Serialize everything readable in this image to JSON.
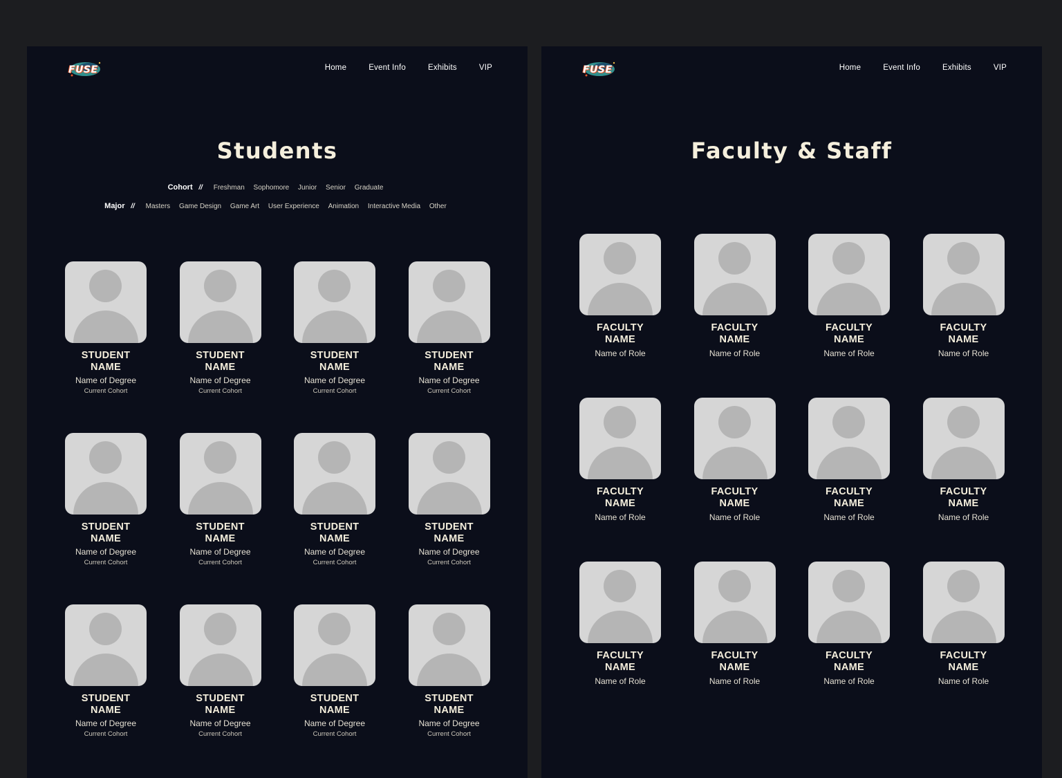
{
  "brand": {
    "logo_text": "FUSE"
  },
  "nav": [
    "Home",
    "Event Info",
    "Exhibits",
    "VIP"
  ],
  "students_page": {
    "title": "Students",
    "cohort_filter": {
      "label": "Cohort",
      "separator": "//",
      "options": [
        "Freshman",
        "Sophomore",
        "Junior",
        "Senior",
        "Graduate"
      ]
    },
    "major_filter": {
      "label": "Major",
      "separator": "//",
      "options": [
        "Masters",
        "Game Design",
        "Game Art",
        "User Experience",
        "Animation",
        "Interactive Media",
        "Other"
      ]
    },
    "cards": [
      {
        "name_line1": "STUDENT",
        "name_line2": "NAME",
        "degree": "Name of Degree",
        "cohort": "Current Cohort"
      },
      {
        "name_line1": "STUDENT",
        "name_line2": "NAME",
        "degree": "Name of Degree",
        "cohort": "Current Cohort"
      },
      {
        "name_line1": "STUDENT",
        "name_line2": "NAME",
        "degree": "Name of Degree",
        "cohort": "Current Cohort"
      },
      {
        "name_line1": "STUDENT",
        "name_line2": "NAME",
        "degree": "Name of Degree",
        "cohort": "Current Cohort"
      },
      {
        "name_line1": "STUDENT",
        "name_line2": "NAME",
        "degree": "Name of Degree",
        "cohort": "Current Cohort"
      },
      {
        "name_line1": "STUDENT",
        "name_line2": "NAME",
        "degree": "Name of Degree",
        "cohort": "Current Cohort"
      },
      {
        "name_line1": "STUDENT",
        "name_line2": "NAME",
        "degree": "Name of Degree",
        "cohort": "Current Cohort"
      },
      {
        "name_line1": "STUDENT",
        "name_line2": "NAME",
        "degree": "Name of Degree",
        "cohort": "Current Cohort"
      },
      {
        "name_line1": "STUDENT",
        "name_line2": "NAME",
        "degree": "Name of Degree",
        "cohort": "Current Cohort"
      },
      {
        "name_line1": "STUDENT",
        "name_line2": "NAME",
        "degree": "Name of Degree",
        "cohort": "Current Cohort"
      },
      {
        "name_line1": "STUDENT",
        "name_line2": "NAME",
        "degree": "Name of Degree",
        "cohort": "Current Cohort"
      },
      {
        "name_line1": "STUDENT",
        "name_line2": "NAME",
        "degree": "Name of Degree",
        "cohort": "Current Cohort"
      }
    ]
  },
  "faculty_page": {
    "title": "Faculty & Staff",
    "cards": [
      {
        "name_line1": "FACULTY",
        "name_line2": "NAME",
        "role": "Name of Role"
      },
      {
        "name_line1": "FACULTY",
        "name_line2": "NAME",
        "role": "Name of Role"
      },
      {
        "name_line1": "FACULTY",
        "name_line2": "NAME",
        "role": "Name of Role"
      },
      {
        "name_line1": "FACULTY",
        "name_line2": "NAME",
        "role": "Name of Role"
      },
      {
        "name_line1": "FACULTY",
        "name_line2": "NAME",
        "role": "Name of Role"
      },
      {
        "name_line1": "FACULTY",
        "name_line2": "NAME",
        "role": "Name of Role"
      },
      {
        "name_line1": "FACULTY",
        "name_line2": "NAME",
        "role": "Name of Role"
      },
      {
        "name_line1": "FACULTY",
        "name_line2": "NAME",
        "role": "Name of Role"
      },
      {
        "name_line1": "FACULTY",
        "name_line2": "NAME",
        "role": "Name of Role"
      },
      {
        "name_line1": "FACULTY",
        "name_line2": "NAME",
        "role": "Name of Role"
      },
      {
        "name_line1": "FACULTY",
        "name_line2": "NAME",
        "role": "Name of Role"
      },
      {
        "name_line1": "FACULTY",
        "name_line2": "NAME",
        "role": "Name of Role"
      }
    ]
  },
  "colors": {
    "page_background": "#1c1d20",
    "panel_background": "#0b0e1a",
    "title_text": "#f5efdd",
    "avatar_background": "#d6d6d6",
    "avatar_silhouette": "#b5b5b5",
    "logo_accent": "#e3572d",
    "logo_swirl": "#3aa7a3"
  }
}
